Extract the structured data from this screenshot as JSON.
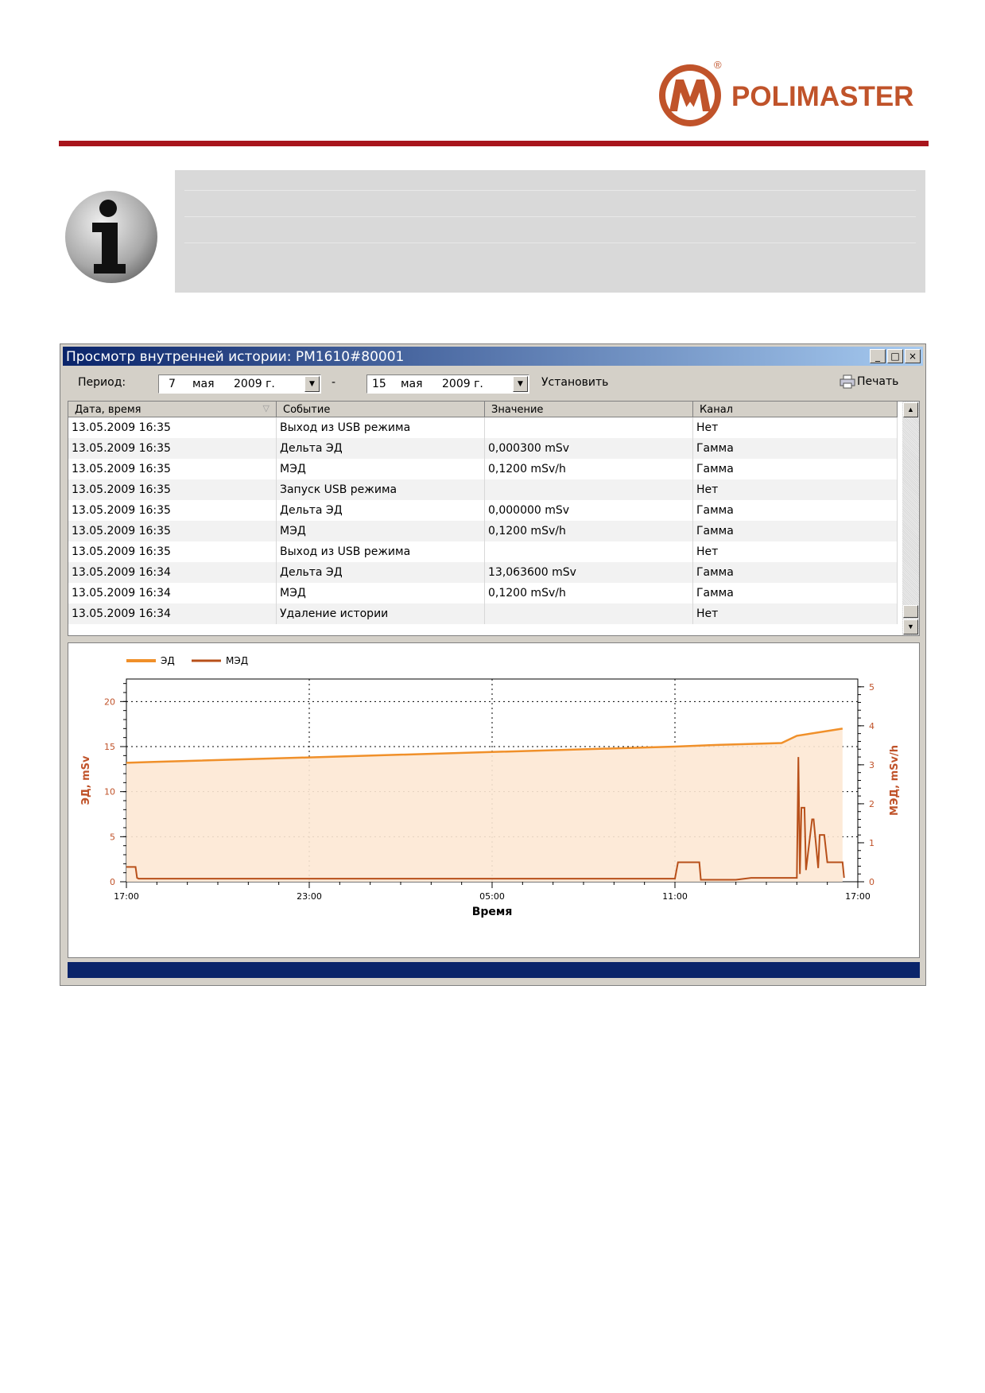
{
  "logo": {
    "text": "POLIMASTER",
    "reg": "®"
  },
  "window": {
    "title": "Просмотр внутренней истории: PM1610#80001",
    "buttons": {
      "minimize": "_",
      "maximize": "□",
      "close": "×"
    }
  },
  "toolbar": {
    "period_label": "Период:",
    "from": {
      "day": "7",
      "month": "мая",
      "year": "2009 г."
    },
    "dash": "-",
    "to": {
      "day": "15",
      "month": "мая",
      "year": "2009 г."
    },
    "set_label": "Установить",
    "print_label": "Печать"
  },
  "table": {
    "columns": [
      "Дата, время",
      "Событие",
      "Значение",
      "Канал"
    ],
    "rows": [
      [
        "13.05.2009 16:35",
        "Выход из USB режима",
        "",
        "Нет"
      ],
      [
        "13.05.2009 16:35",
        "Дельта ЭД",
        "0,000300 mSv",
        "Гамма"
      ],
      [
        "13.05.2009 16:35",
        "МЭД",
        "0,1200 mSv/h",
        "Гамма"
      ],
      [
        "13.05.2009 16:35",
        "Запуск USB режима",
        "",
        "Нет"
      ],
      [
        "13.05.2009 16:35",
        "Дельта ЭД",
        "0,000000 mSv",
        "Гамма"
      ],
      [
        "13.05.2009 16:35",
        "МЭД",
        "0,1200 mSv/h",
        "Гамма"
      ],
      [
        "13.05.2009 16:35",
        "Выход из USB режима",
        "",
        "Нет"
      ],
      [
        "13.05.2009 16:34",
        "Дельта ЭД",
        "13,063600 mSv",
        "Гамма"
      ],
      [
        "13.05.2009 16:34",
        "МЭД",
        "0,1200 mSv/h",
        "Гамма"
      ],
      [
        "13.05.2009 16:34",
        "Удаление истории",
        "",
        "Нет"
      ]
    ]
  },
  "colors": {
    "ed": "#f0902a",
    "med": "#b8501a",
    "fill": "#fde8d4",
    "brand": "#c0532a"
  },
  "chart_data": {
    "type": "line",
    "xlabel": "Время",
    "ylabel_left": "ЭД, mSv",
    "ylabel_right": "МЭД, mSv/h",
    "x_ticks": [
      "17:00",
      "23:00",
      "05:00",
      "11:00",
      "17:00"
    ],
    "x_range_hours": [
      0,
      24
    ],
    "ylim_left": [
      0,
      22.5
    ],
    "yticks_left": [
      0,
      5,
      10,
      15,
      20
    ],
    "ylim_right": [
      0,
      5.2
    ],
    "yticks_right": [
      0,
      1,
      2,
      3,
      4,
      5
    ],
    "legend_position": "top-left",
    "series": [
      {
        "name": "ЭД",
        "axis": "left",
        "x": [
          0.0,
          0.9,
          6.0,
          12.0,
          18.0,
          19.5,
          21.5,
          22.0,
          23.5
        ],
        "y": [
          13.2,
          13.3,
          13.8,
          14.4,
          15.0,
          15.2,
          15.4,
          16.2,
          17.0
        ]
      },
      {
        "name": "МЭД",
        "axis": "right",
        "x": [
          0.0,
          0.3,
          0.35,
          0.4,
          6.0,
          12.0,
          18.0,
          18.1,
          18.15,
          18.8,
          18.85,
          20.0,
          20.5,
          22.0,
          22.05,
          22.1,
          22.15,
          22.25,
          22.3,
          22.5,
          22.55,
          22.7,
          22.75,
          22.9,
          23.0,
          23.1,
          23.5,
          23.55
        ],
        "y": [
          0.38,
          0.38,
          0.1,
          0.08,
          0.08,
          0.08,
          0.08,
          0.5,
          0.5,
          0.5,
          0.05,
          0.05,
          0.1,
          0.1,
          3.2,
          0.2,
          1.9,
          1.9,
          0.3,
          1.6,
          1.6,
          0.35,
          1.2,
          1.2,
          0.5,
          0.5,
          0.5,
          0.1
        ]
      }
    ]
  }
}
